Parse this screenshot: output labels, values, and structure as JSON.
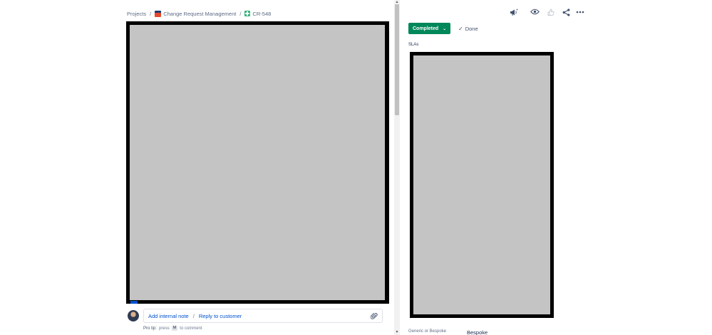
{
  "breadcrumb": {
    "projects": "Projects",
    "separator": "/",
    "project_name": "Change Request Management",
    "issue_key": "CR-548"
  },
  "comment": {
    "add_internal_note": "Add internal note",
    "separator": "/",
    "reply_to_customer": "Reply to customer",
    "protip_label": "Pro tip:",
    "protip_press": "press",
    "protip_key": "M",
    "protip_suffix": "to comment"
  },
  "header_icons": [
    "megaphone-icon",
    "eye-icon",
    "thumbs-up-icon",
    "share-icon",
    "more-icon"
  ],
  "status": {
    "label": "Completed",
    "resolution": "Done",
    "color": "#00875a"
  },
  "sections": {
    "slas": "SLAs"
  },
  "fields": [
    {
      "label": "Generic or Bespoke",
      "value": "Bespoke"
    }
  ],
  "colors": {
    "link": "#0052cc",
    "redaction_fill": "#c4c4c4",
    "redaction_border": "#000000"
  }
}
